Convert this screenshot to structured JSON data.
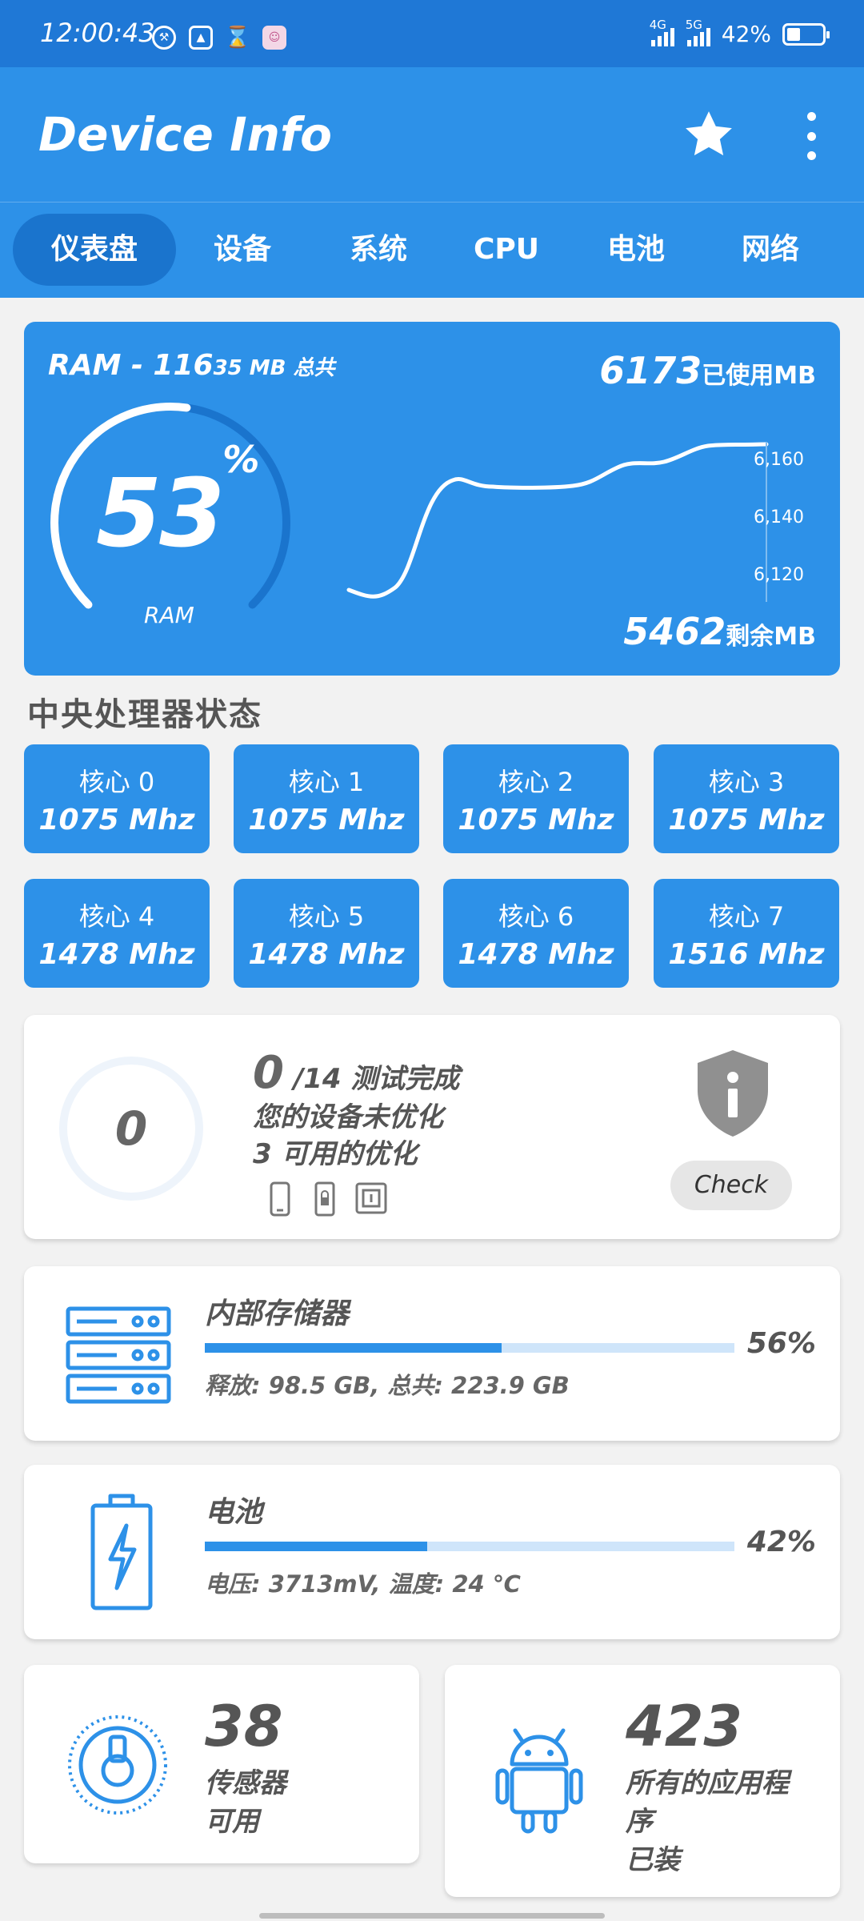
{
  "status_bar": {
    "time": "12:00:43",
    "net1": "4G",
    "net2": "5G",
    "battery": "42%"
  },
  "app": {
    "title": "Device Info"
  },
  "tabs": [
    "仪表盘",
    "设备",
    "系统",
    "CPU",
    "电池",
    "网络"
  ],
  "ram": {
    "title_main": "RAM - 116",
    "title_small": "35 MB 总共",
    "used_value": "6173",
    "used_label": "已使用MB",
    "free_value": "5462",
    "free_label": "剩余MB",
    "percent": "53",
    "percent_sign": "%",
    "percent_value": 53,
    "gauge_label": "RAM",
    "y_ticks": [
      "6,160",
      "6,140",
      "6,120"
    ],
    "colors": {
      "card": "#2d91e8",
      "track": "#1a74cd",
      "line": "#ffffff"
    }
  },
  "cpu": {
    "title": "中央处理器状态",
    "cores": [
      {
        "name": "核心 0",
        "freq": "1075 Mhz"
      },
      {
        "name": "核心 1",
        "freq": "1075 Mhz"
      },
      {
        "name": "核心 2",
        "freq": "1075 Mhz"
      },
      {
        "name": "核心 3",
        "freq": "1075 Mhz"
      },
      {
        "name": "核心 4",
        "freq": "1478 Mhz"
      },
      {
        "name": "核心 5",
        "freq": "1478 Mhz"
      },
      {
        "name": "核心 6",
        "freq": "1478 Mhz"
      },
      {
        "name": "核心 7",
        "freq": "1516 Mhz"
      }
    ]
  },
  "optimize": {
    "score": "0",
    "count": "0",
    "total": "/14 测试完成",
    "line2": "您的设备未优化",
    "line3": "3 可用的优化",
    "icons": [
      "phone-icon",
      "lock-icon",
      "nfc-icon"
    ],
    "button": "Check"
  },
  "storage": {
    "title": "内部存储器",
    "percent_text": "56%",
    "percent": 56,
    "detail": "释放: 98.5 GB, 总共: 223.9 GB",
    "icon": "server-icon"
  },
  "battery": {
    "title": "电池",
    "percent_text": "42%",
    "percent": 42,
    "detail": "电压: 3713mV, 温度: 24 ℃",
    "icon": "battery-bolt-icon"
  },
  "sensors": {
    "count": "38",
    "label1": "传感器",
    "label2": "可用",
    "icon": "sensor-icon"
  },
  "apps": {
    "count": "423",
    "label1": "所有的应用程",
    "label2": "序",
    "label3": "已装",
    "icon": "android-icon"
  },
  "colors": {
    "accent": "#2d91e8",
    "accent_dark": "#1a74cd",
    "statusbar": "#1f78d6",
    "bg": "#f2f2f2"
  }
}
